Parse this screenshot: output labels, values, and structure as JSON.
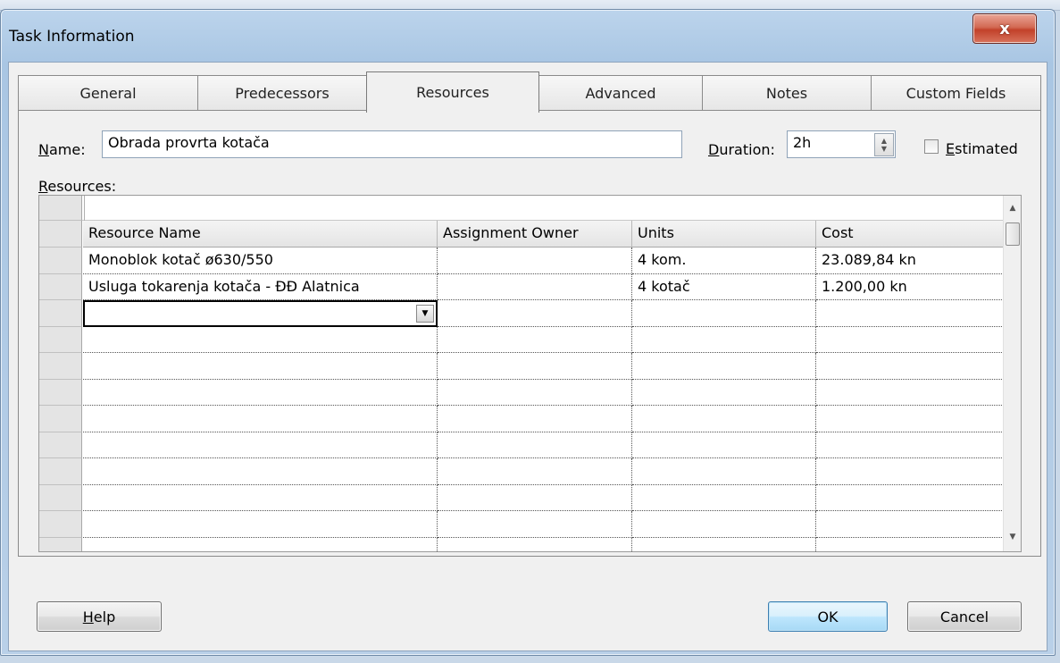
{
  "dialog": {
    "title": "Task Information",
    "close_label": "x"
  },
  "tabs": [
    {
      "label": "General"
    },
    {
      "label": "Predecessors"
    },
    {
      "label": "Resources",
      "active": true
    },
    {
      "label": "Advanced"
    },
    {
      "label": "Notes"
    },
    {
      "label": "Custom Fields"
    }
  ],
  "form": {
    "name_label_u": "N",
    "name_label_rest": "ame:",
    "name_value": "Obrada provrta kotača",
    "duration_label_u": "D",
    "duration_label_rest": "uration:",
    "duration_value": "2h",
    "estimated_label_u": "E",
    "estimated_label_rest": "stimated",
    "estimated_checked": false,
    "resources_label_u": "R",
    "resources_label_rest": "esources:"
  },
  "grid": {
    "entry_value": "",
    "columns": [
      "Resource Name",
      "Assignment Owner",
      "Units",
      "Cost"
    ],
    "rows": [
      [
        "Monoblok kotač ø630/550",
        "",
        "4 kom.",
        "23.089,84 kn"
      ],
      [
        "Usluga tokarenja kotača - ĐĐ Alatnica",
        "",
        "4 kotač",
        "1.200,00 kn"
      ],
      [
        "",
        "",
        "",
        ""
      ],
      [
        "",
        "",
        "",
        ""
      ],
      [
        "",
        "",
        "",
        ""
      ],
      [
        "",
        "",
        "",
        ""
      ],
      [
        "",
        "",
        "",
        ""
      ],
      [
        "",
        "",
        "",
        ""
      ],
      [
        "",
        "",
        "",
        ""
      ],
      [
        "",
        "",
        "",
        ""
      ],
      [
        "",
        "",
        "",
        ""
      ],
      [
        "",
        "",
        "",
        ""
      ],
      [
        "",
        "",
        "",
        ""
      ]
    ]
  },
  "buttons": {
    "help_u": "H",
    "help_rest": "elp",
    "ok": "OK",
    "cancel": "Cancel"
  },
  "icons": {
    "close": "close-icon",
    "spin": "spin-up-down-icon",
    "dropdown": "chevron-down-icon",
    "scroll_up": "scroll-up-icon",
    "scroll_down": "scroll-down-icon"
  }
}
